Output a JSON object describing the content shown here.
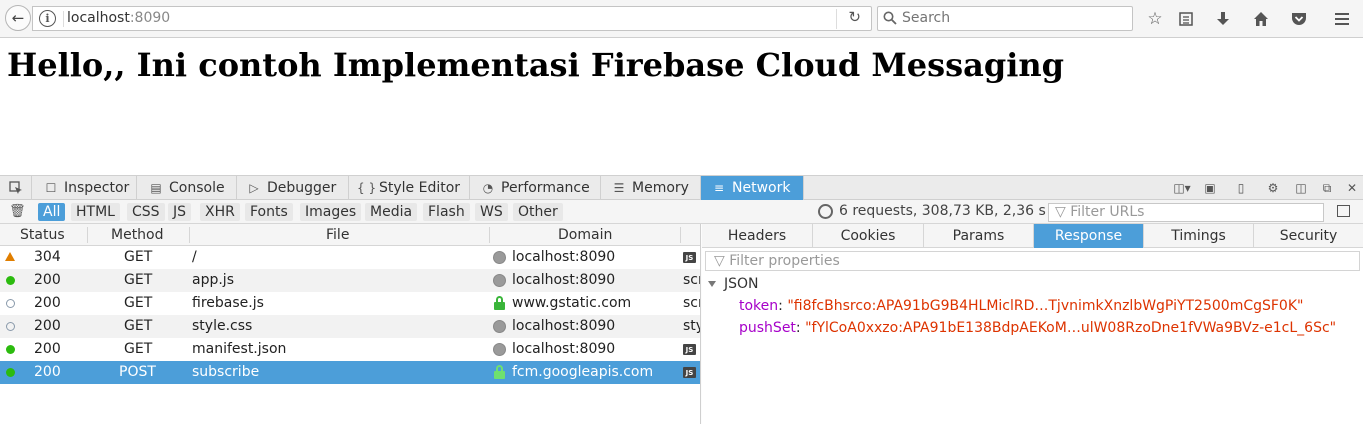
{
  "browser": {
    "url_host": "localhost",
    "url_port": ":8090",
    "search_placeholder": "Search"
  },
  "page": {
    "heading": "Hello,, Ini contoh Implementasi Firebase Cloud Messaging"
  },
  "devtools": {
    "tabs": [
      {
        "label": "Inspector",
        "icon": "inspector-icon"
      },
      {
        "label": "Console",
        "icon": "console-icon"
      },
      {
        "label": "Debugger",
        "icon": "debugger-icon"
      },
      {
        "label": "Style Editor",
        "icon": "style-editor-icon"
      },
      {
        "label": "Performance",
        "icon": "performance-icon"
      },
      {
        "label": "Memory",
        "icon": "memory-icon"
      },
      {
        "label": "Network",
        "icon": "network-icon"
      }
    ],
    "active_tab": "Network",
    "filters": [
      "All",
      "HTML",
      "CSS",
      "JS",
      "XHR",
      "Fonts",
      "Images",
      "Media",
      "Flash",
      "WS",
      "Other"
    ],
    "active_filter": "All",
    "summary": "6 requests, 308,73 KB, 2,36 s",
    "filter_urls_placeholder": "Filter URLs",
    "columns": [
      "Status",
      "Method",
      "File",
      "Domain"
    ],
    "requests": [
      {
        "status": "304",
        "status_kind": "warning",
        "method": "GET",
        "file": "/",
        "domain": "localhost:8090",
        "secure": false,
        "cause": "js-badge"
      },
      {
        "status": "200",
        "status_kind": "ok",
        "method": "GET",
        "file": "app.js",
        "domain": "localhost:8090",
        "secure": false,
        "cause": "scr"
      },
      {
        "status": "200",
        "status_kind": "cached",
        "method": "GET",
        "file": "firebase.js",
        "domain": "www.gstatic.com",
        "secure": true,
        "cause": "scr"
      },
      {
        "status": "200",
        "status_kind": "cached",
        "method": "GET",
        "file": "style.css",
        "domain": "localhost:8090",
        "secure": false,
        "cause": "sty"
      },
      {
        "status": "200",
        "status_kind": "ok",
        "method": "GET",
        "file": "manifest.json",
        "domain": "localhost:8090",
        "secure": false,
        "cause": "js-badge"
      },
      {
        "status": "200",
        "status_kind": "ok",
        "method": "POST",
        "file": "subscribe",
        "domain": "fcm.googleapis.com",
        "secure": true,
        "cause": "js-badge"
      }
    ],
    "selected_request_index": 5,
    "detail_tabs": [
      "Headers",
      "Cookies",
      "Params",
      "Response",
      "Timings",
      "Security"
    ],
    "active_detail_tab": "Response",
    "filter_properties_placeholder": "Filter properties",
    "response": {
      "section_title": "JSON",
      "fields": [
        {
          "key": "token",
          "value": "\"fi8fcBhsrco:APA91bG9B4HLMiclRD…TjvnimkXnzlbWgPiYT2500mCgSF0K\""
        },
        {
          "key": "pushSet",
          "value": "\"fYlCoA0xxzo:APA91bE138BdpAEKoM…ulW08RzoDne1fVWa9BVz-e1cL_6Sc\""
        }
      ]
    },
    "colors": {
      "accent": "#4c9ed9",
      "json_key": "#a600c9",
      "json_value": "#dd3300",
      "status_ok": "#2cbb0f",
      "status_warning": "#e07e00"
    }
  }
}
